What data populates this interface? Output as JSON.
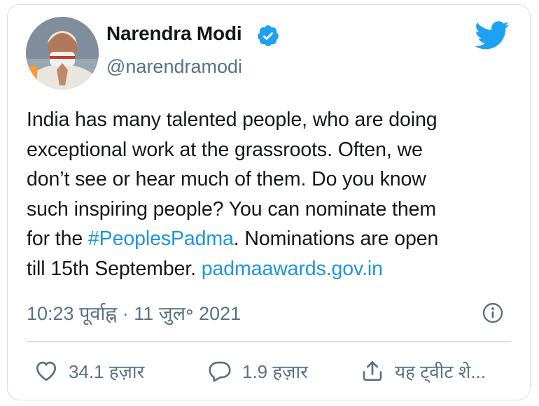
{
  "tweet": {
    "author_name": "Narendra Modi",
    "handle": "@narendramodi",
    "verified": true,
    "text_lines": [
      [
        {
          "t": "India has many talented people, who are doing"
        }
      ],
      [
        {
          "t": "exceptional work at the grassroots. Often, we"
        }
      ],
      [
        {
          "t": "don’t see or hear much of them. Do you know"
        }
      ],
      [
        {
          "t": "such inspiring people? You can nominate them"
        }
      ],
      [
        {
          "t": "for the "
        },
        {
          "t": "#PeoplesPadma",
          "link": true
        },
        {
          "t": ". Nominations are open"
        }
      ],
      [
        {
          "t": "till 15th September. "
        },
        {
          "t": "padmaawards.gov.in",
          "link": true
        }
      ]
    ],
    "timestamp": "10:23 पूर्वाह्न · 11 जुल॰ 2021"
  },
  "actions": {
    "likes": "34.1 हज़ार",
    "replies": "1.9 हज़ार",
    "share_label": "यह ट्वीट शे..."
  },
  "icons": {
    "brand": "twitter-bird-icon",
    "verified": "verified-badge-icon",
    "info": "info-icon",
    "like": "heart-icon",
    "reply": "reply-bubble-icon",
    "share": "share-icon"
  },
  "colors": {
    "brand": "#1da1f2",
    "link": "#1b95e0",
    "text": "#14171a",
    "secondary": "#5b7083",
    "border": "#d9dee3"
  }
}
